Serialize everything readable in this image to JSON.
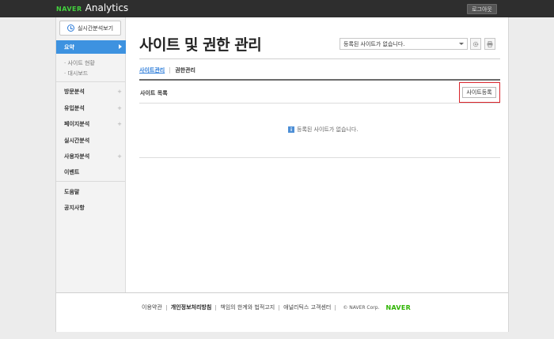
{
  "header": {
    "logo_brand": "NAVER",
    "logo_product": "Analytics",
    "logout_label": "로그아웃"
  },
  "sidebar": {
    "realtime_button": "실시간분석보기",
    "active_item": "요약",
    "sub_items": [
      "· 사이트 현황",
      "· 대시보드"
    ],
    "items": [
      {
        "label": "방문분석",
        "expandable": true
      },
      {
        "label": "유입분석",
        "expandable": true
      },
      {
        "label": "페이지분석",
        "expandable": true
      },
      {
        "label": "실시간분석",
        "expandable": false
      },
      {
        "label": "사용자분석",
        "expandable": true
      },
      {
        "label": "이벤트",
        "expandable": false
      }
    ],
    "bottom_items": [
      "도움말",
      "공지사항"
    ],
    "plus_glyph": "+"
  },
  "main": {
    "title": "사이트 및 권한 관리",
    "site_select_value": "등록된 사이트가 없습니다.",
    "tabs": [
      {
        "label": "사이트관리",
        "active": true
      },
      {
        "label": "권한관리",
        "active": false
      }
    ],
    "list_label": "사이트 목록",
    "register_button": "사이트등록",
    "empty_message": "등록된 사이트가 없습니다.",
    "info_glyph": "i"
  },
  "footer": {
    "links": [
      "이용약관",
      "개인정보처리방침",
      "책임의 한계와 법적고지",
      "애널리틱스 고객센터"
    ],
    "bold_link_index": 1,
    "copyright": "© NAVER Corp.",
    "brand": "NAVER"
  },
  "colors": {
    "accent": "#3d92e0",
    "naver_green": "#2db400",
    "highlight_red": "#d9242b"
  }
}
